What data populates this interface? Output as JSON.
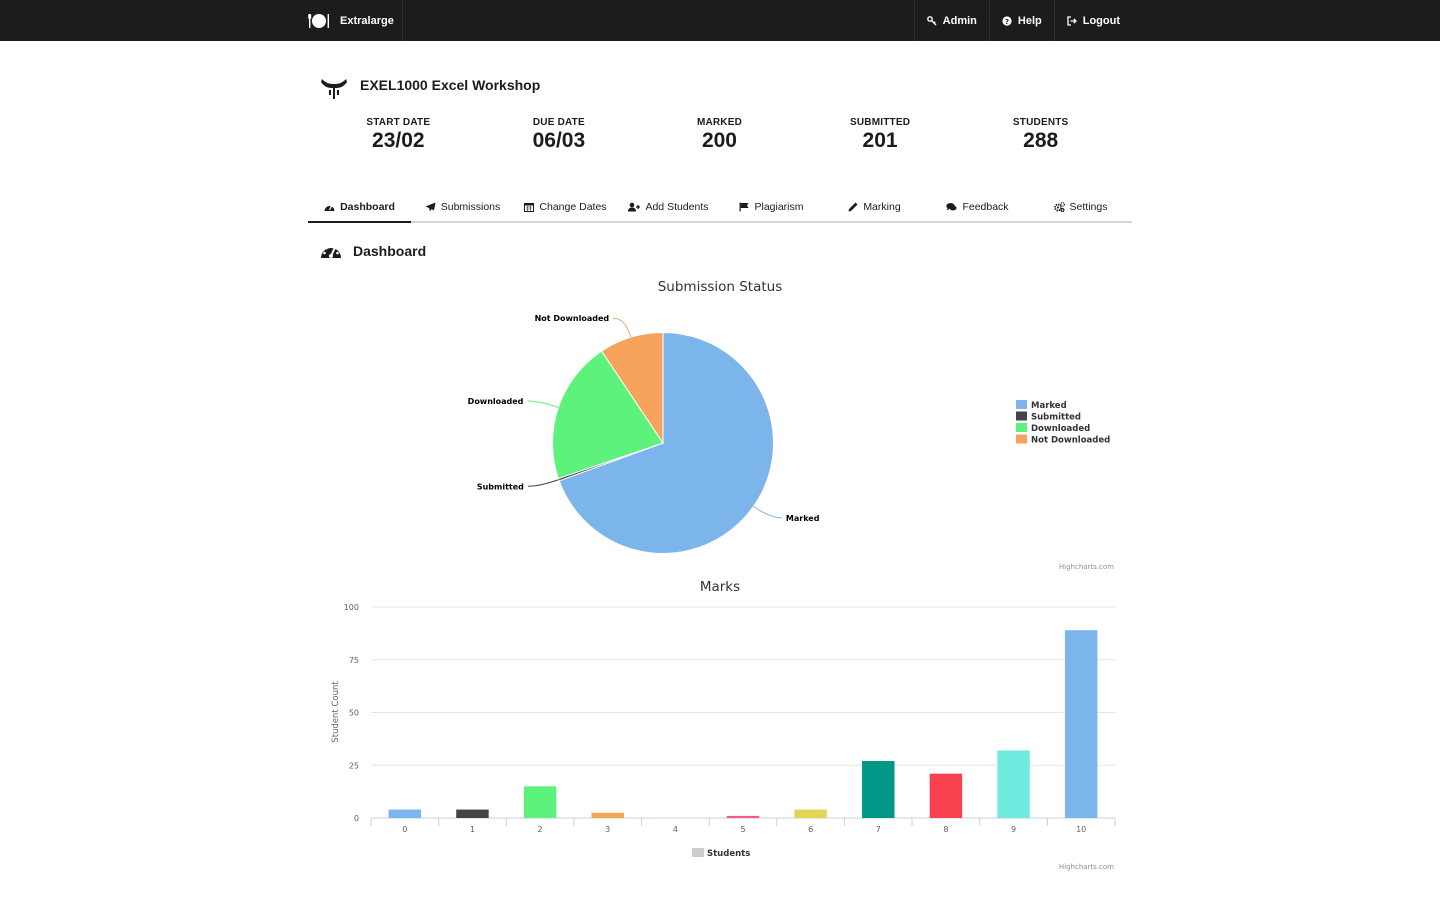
{
  "navbar": {
    "brand": "Extralarge",
    "items": [
      {
        "label": "Admin",
        "icon": "key-icon"
      },
      {
        "label": "Help",
        "icon": "help-circle-icon"
      },
      {
        "label": "Logout",
        "icon": "logout-icon"
      }
    ]
  },
  "course": {
    "title": "EXEL1000 Excel Workshop"
  },
  "stats": [
    {
      "label": "START DATE",
      "value": "23/02"
    },
    {
      "label": "DUE DATE",
      "value": "06/03"
    },
    {
      "label": "MARKED",
      "value": "200"
    },
    {
      "label": "SUBMITTED",
      "value": "201"
    },
    {
      "label": "STUDENTS",
      "value": "288"
    }
  ],
  "tabs": [
    {
      "label": "Dashboard",
      "icon": "dashboard-icon",
      "active": true
    },
    {
      "label": "Submissions",
      "icon": "paper-plane-icon"
    },
    {
      "label": "Change Dates",
      "icon": "calendar-icon"
    },
    {
      "label": "Add Students",
      "icon": "add-user-icon"
    },
    {
      "label": "Plagiarism",
      "icon": "flag-icon"
    },
    {
      "label": "Marking",
      "icon": "pencil-icon"
    },
    {
      "label": "Feedback",
      "icon": "comments-icon"
    },
    {
      "label": "Settings",
      "icon": "settings-icon"
    }
  ],
  "section": {
    "title": "Dashboard"
  },
  "chart_data": [
    {
      "type": "pie",
      "title": "Submission Status",
      "slices": [
        {
          "name": "Marked",
          "value": 200,
          "color": "#7cb5ec"
        },
        {
          "name": "Submitted",
          "value": 1,
          "color": "#434348"
        },
        {
          "name": "Downloaded",
          "value": 60,
          "color": "#5cf27c"
        },
        {
          "name": "Not Downloaded",
          "value": 27,
          "color": "#f7a35c"
        }
      ],
      "legend": "right",
      "credit": "Highcharts.com"
    },
    {
      "type": "bar",
      "title": "Marks",
      "categories": [
        "0",
        "1",
        "2",
        "3",
        "4",
        "5",
        "6",
        "7",
        "8",
        "9",
        "10"
      ],
      "series": [
        {
          "name": "Students",
          "values": [
            4,
            4,
            15,
            2.5,
            0,
            1,
            4,
            27,
            21,
            32,
            89
          ]
        }
      ],
      "colors": [
        "#7cb5ec",
        "#434348",
        "#5cf27c",
        "#f7a35c",
        "#8085e9",
        "#f15c80",
        "#e4d354",
        "#009688",
        "#f7414e",
        "#71eae0",
        "#7cb5ec"
      ],
      "ylabel": "Student Count",
      "xlabel": "",
      "ylim": [
        0,
        100
      ],
      "yticks": [
        0,
        25,
        50,
        75,
        100
      ],
      "legend": "bottom",
      "credit": "Highcharts.com"
    }
  ]
}
